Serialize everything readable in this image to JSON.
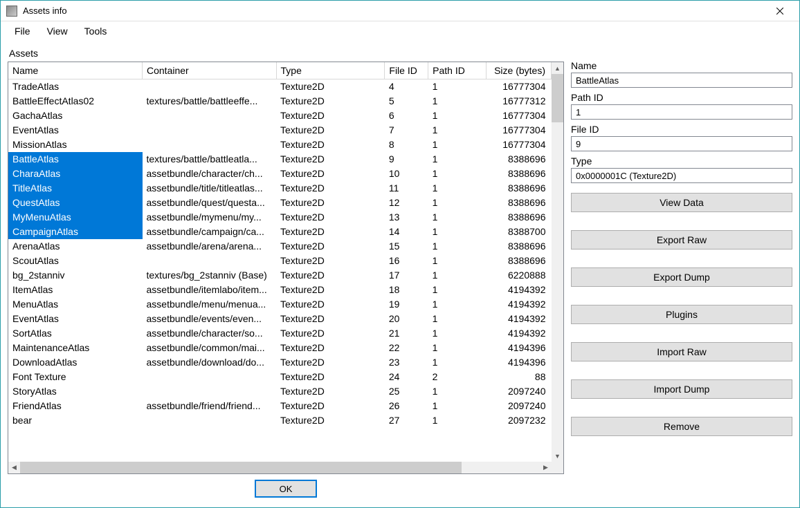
{
  "window": {
    "title": "Assets info"
  },
  "menubar": {
    "file": "File",
    "view": "View",
    "tools": "Tools"
  },
  "assets_label": "Assets",
  "columns": {
    "name": "Name",
    "container": "Container",
    "type": "Type",
    "file_id": "File ID",
    "path_id": "Path ID",
    "size": "Size (bytes)"
  },
  "rows": [
    {
      "name": "TradeAtlas",
      "container": "",
      "type": "Texture2D",
      "file_id": "4",
      "path_id": "1",
      "size": "16777304",
      "selected": false
    },
    {
      "name": "BattleEffectAtlas02",
      "container": "textures/battle/battleeffe...",
      "type": "Texture2D",
      "file_id": "5",
      "path_id": "1",
      "size": "16777312",
      "selected": false
    },
    {
      "name": "GachaAtlas",
      "container": "",
      "type": "Texture2D",
      "file_id": "6",
      "path_id": "1",
      "size": "16777304",
      "selected": false
    },
    {
      "name": "EventAtlas",
      "container": "",
      "type": "Texture2D",
      "file_id": "7",
      "path_id": "1",
      "size": "16777304",
      "selected": false
    },
    {
      "name": "MissionAtlas",
      "container": "",
      "type": "Texture2D",
      "file_id": "8",
      "path_id": "1",
      "size": "16777304",
      "selected": false
    },
    {
      "name": "BattleAtlas",
      "container": "textures/battle/battleatla...",
      "type": "Texture2D",
      "file_id": "9",
      "path_id": "1",
      "size": "8388696",
      "selected": true
    },
    {
      "name": "CharaAtlas",
      "container": "assetbundle/character/ch...",
      "type": "Texture2D",
      "file_id": "10",
      "path_id": "1",
      "size": "8388696",
      "selected": true
    },
    {
      "name": "TitleAtlas",
      "container": "assetbundle/title/titleatlas...",
      "type": "Texture2D",
      "file_id": "11",
      "path_id": "1",
      "size": "8388696",
      "selected": true
    },
    {
      "name": "QuestAtlas",
      "container": "assetbundle/quest/questa...",
      "type": "Texture2D",
      "file_id": "12",
      "path_id": "1",
      "size": "8388696",
      "selected": true
    },
    {
      "name": "MyMenuAtlas",
      "container": "assetbundle/mymenu/my...",
      "type": "Texture2D",
      "file_id": "13",
      "path_id": "1",
      "size": "8388696",
      "selected": true
    },
    {
      "name": "CampaignAtlas",
      "container": "assetbundle/campaign/ca...",
      "type": "Texture2D",
      "file_id": "14",
      "path_id": "1",
      "size": "8388700",
      "selected": true
    },
    {
      "name": "ArenaAtlas",
      "container": "assetbundle/arena/arena...",
      "type": "Texture2D",
      "file_id": "15",
      "path_id": "1",
      "size": "8388696",
      "selected": false
    },
    {
      "name": "ScoutAtlas",
      "container": "",
      "type": "Texture2D",
      "file_id": "16",
      "path_id": "1",
      "size": "8388696",
      "selected": false
    },
    {
      "name": "bg_2stanniv",
      "container": "textures/bg_2stanniv (Base)",
      "type": "Texture2D",
      "file_id": "17",
      "path_id": "1",
      "size": "6220888",
      "selected": false
    },
    {
      "name": "ItemAtlas",
      "container": "assetbundle/itemlabo/item...",
      "type": "Texture2D",
      "file_id": "18",
      "path_id": "1",
      "size": "4194392",
      "selected": false
    },
    {
      "name": "MenuAtlas",
      "container": "assetbundle/menu/menua...",
      "type": "Texture2D",
      "file_id": "19",
      "path_id": "1",
      "size": "4194392",
      "selected": false
    },
    {
      "name": "EventAtlas",
      "container": "assetbundle/events/even...",
      "type": "Texture2D",
      "file_id": "20",
      "path_id": "1",
      "size": "4194392",
      "selected": false
    },
    {
      "name": "SortAtlas",
      "container": "assetbundle/character/so...",
      "type": "Texture2D",
      "file_id": "21",
      "path_id": "1",
      "size": "4194392",
      "selected": false
    },
    {
      "name": "MaintenanceAtlas",
      "container": "assetbundle/common/mai...",
      "type": "Texture2D",
      "file_id": "22",
      "path_id": "1",
      "size": "4194396",
      "selected": false
    },
    {
      "name": "DownloadAtlas",
      "container": "assetbundle/download/do...",
      "type": "Texture2D",
      "file_id": "23",
      "path_id": "1",
      "size": "4194396",
      "selected": false
    },
    {
      "name": "Font Texture",
      "container": "",
      "type": "Texture2D",
      "file_id": "24",
      "path_id": "2",
      "size": "88",
      "selected": false
    },
    {
      "name": "StoryAtlas",
      "container": "",
      "type": "Texture2D",
      "file_id": "25",
      "path_id": "1",
      "size": "2097240",
      "selected": false
    },
    {
      "name": "FriendAtlas",
      "container": "assetbundle/friend/friend...",
      "type": "Texture2D",
      "file_id": "26",
      "path_id": "1",
      "size": "2097240",
      "selected": false
    },
    {
      "name": "bear",
      "container": "",
      "type": "Texture2D",
      "file_id": "27",
      "path_id": "1",
      "size": "2097232",
      "selected": false
    }
  ],
  "detail": {
    "name_label": "Name",
    "name_value": "BattleAtlas",
    "path_id_label": "Path ID",
    "path_id_value": "1",
    "file_id_label": "File ID",
    "file_id_value": "9",
    "type_label": "Type",
    "type_value": "0x0000001C (Texture2D)"
  },
  "actions": {
    "view_data": "View Data",
    "export_raw": "Export Raw",
    "export_dump": "Export Dump",
    "plugins": "Plugins",
    "import_raw": "Import Raw",
    "import_dump": "Import Dump",
    "remove": "Remove"
  },
  "ok_label": "OK"
}
